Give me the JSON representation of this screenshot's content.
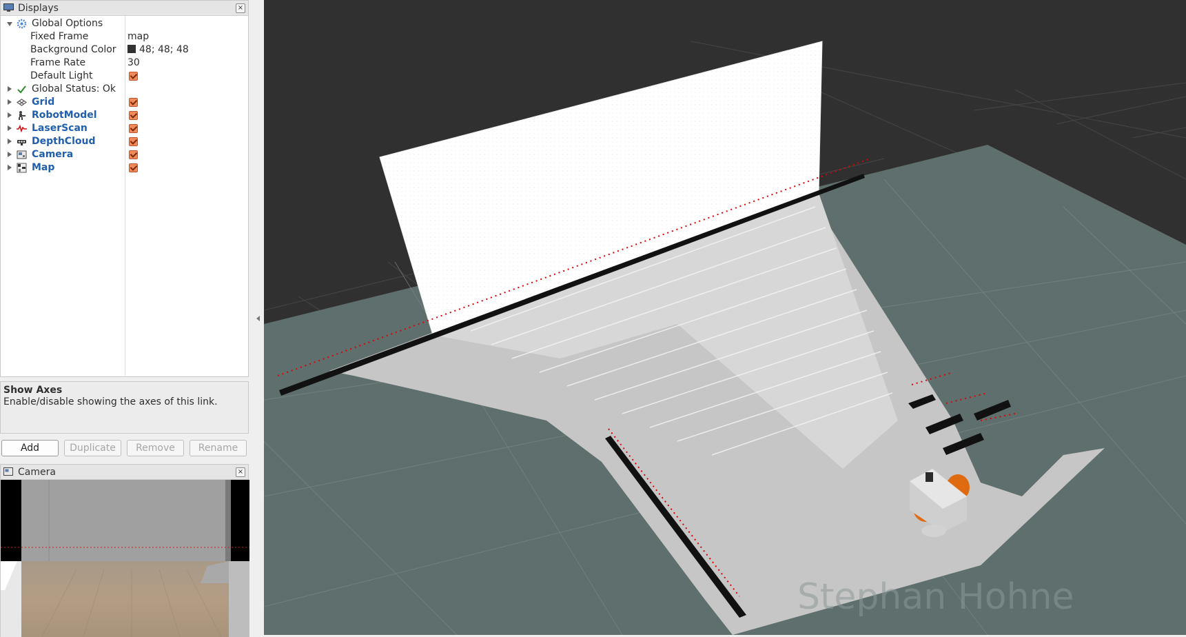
{
  "displays_panel": {
    "title": "Displays",
    "global_options": {
      "label": "Global Options",
      "fixed_frame_label": "Fixed Frame",
      "fixed_frame_value": "map",
      "background_color_label": "Background Color",
      "background_color_value": "48; 48; 48",
      "background_color_hex": "#303030",
      "frame_rate_label": "Frame Rate",
      "frame_rate_value": "30",
      "default_light_label": "Default Light",
      "default_light_checked": true
    },
    "global_status": "Global Status: Ok",
    "displays": [
      {
        "label": "Grid",
        "icon": "grid-icon",
        "checked": true
      },
      {
        "label": "RobotModel",
        "icon": "robot-model-icon",
        "checked": true
      },
      {
        "label": "LaserScan",
        "icon": "laser-scan-icon",
        "checked": true
      },
      {
        "label": "DepthCloud",
        "icon": "depth-cloud-icon",
        "checked": true
      },
      {
        "label": "Camera",
        "icon": "camera-icon",
        "checked": true
      },
      {
        "label": "Map",
        "icon": "map-icon",
        "checked": true
      }
    ]
  },
  "description": {
    "heading": "Show Axes",
    "text": "Enable/disable showing the axes of this link."
  },
  "buttons": {
    "add": "Add",
    "duplicate": "Duplicate",
    "remove": "Remove",
    "rename": "Rename"
  },
  "camera_panel": {
    "title": "Camera"
  },
  "viewport": {
    "watermark": "Stephan Hohne",
    "colors": {
      "background": "#303030",
      "floor": "#5f6f6d",
      "map_free": "#c6c6c6",
      "laser_points": "#e00000",
      "robot_wheels": "#e06a10"
    }
  }
}
